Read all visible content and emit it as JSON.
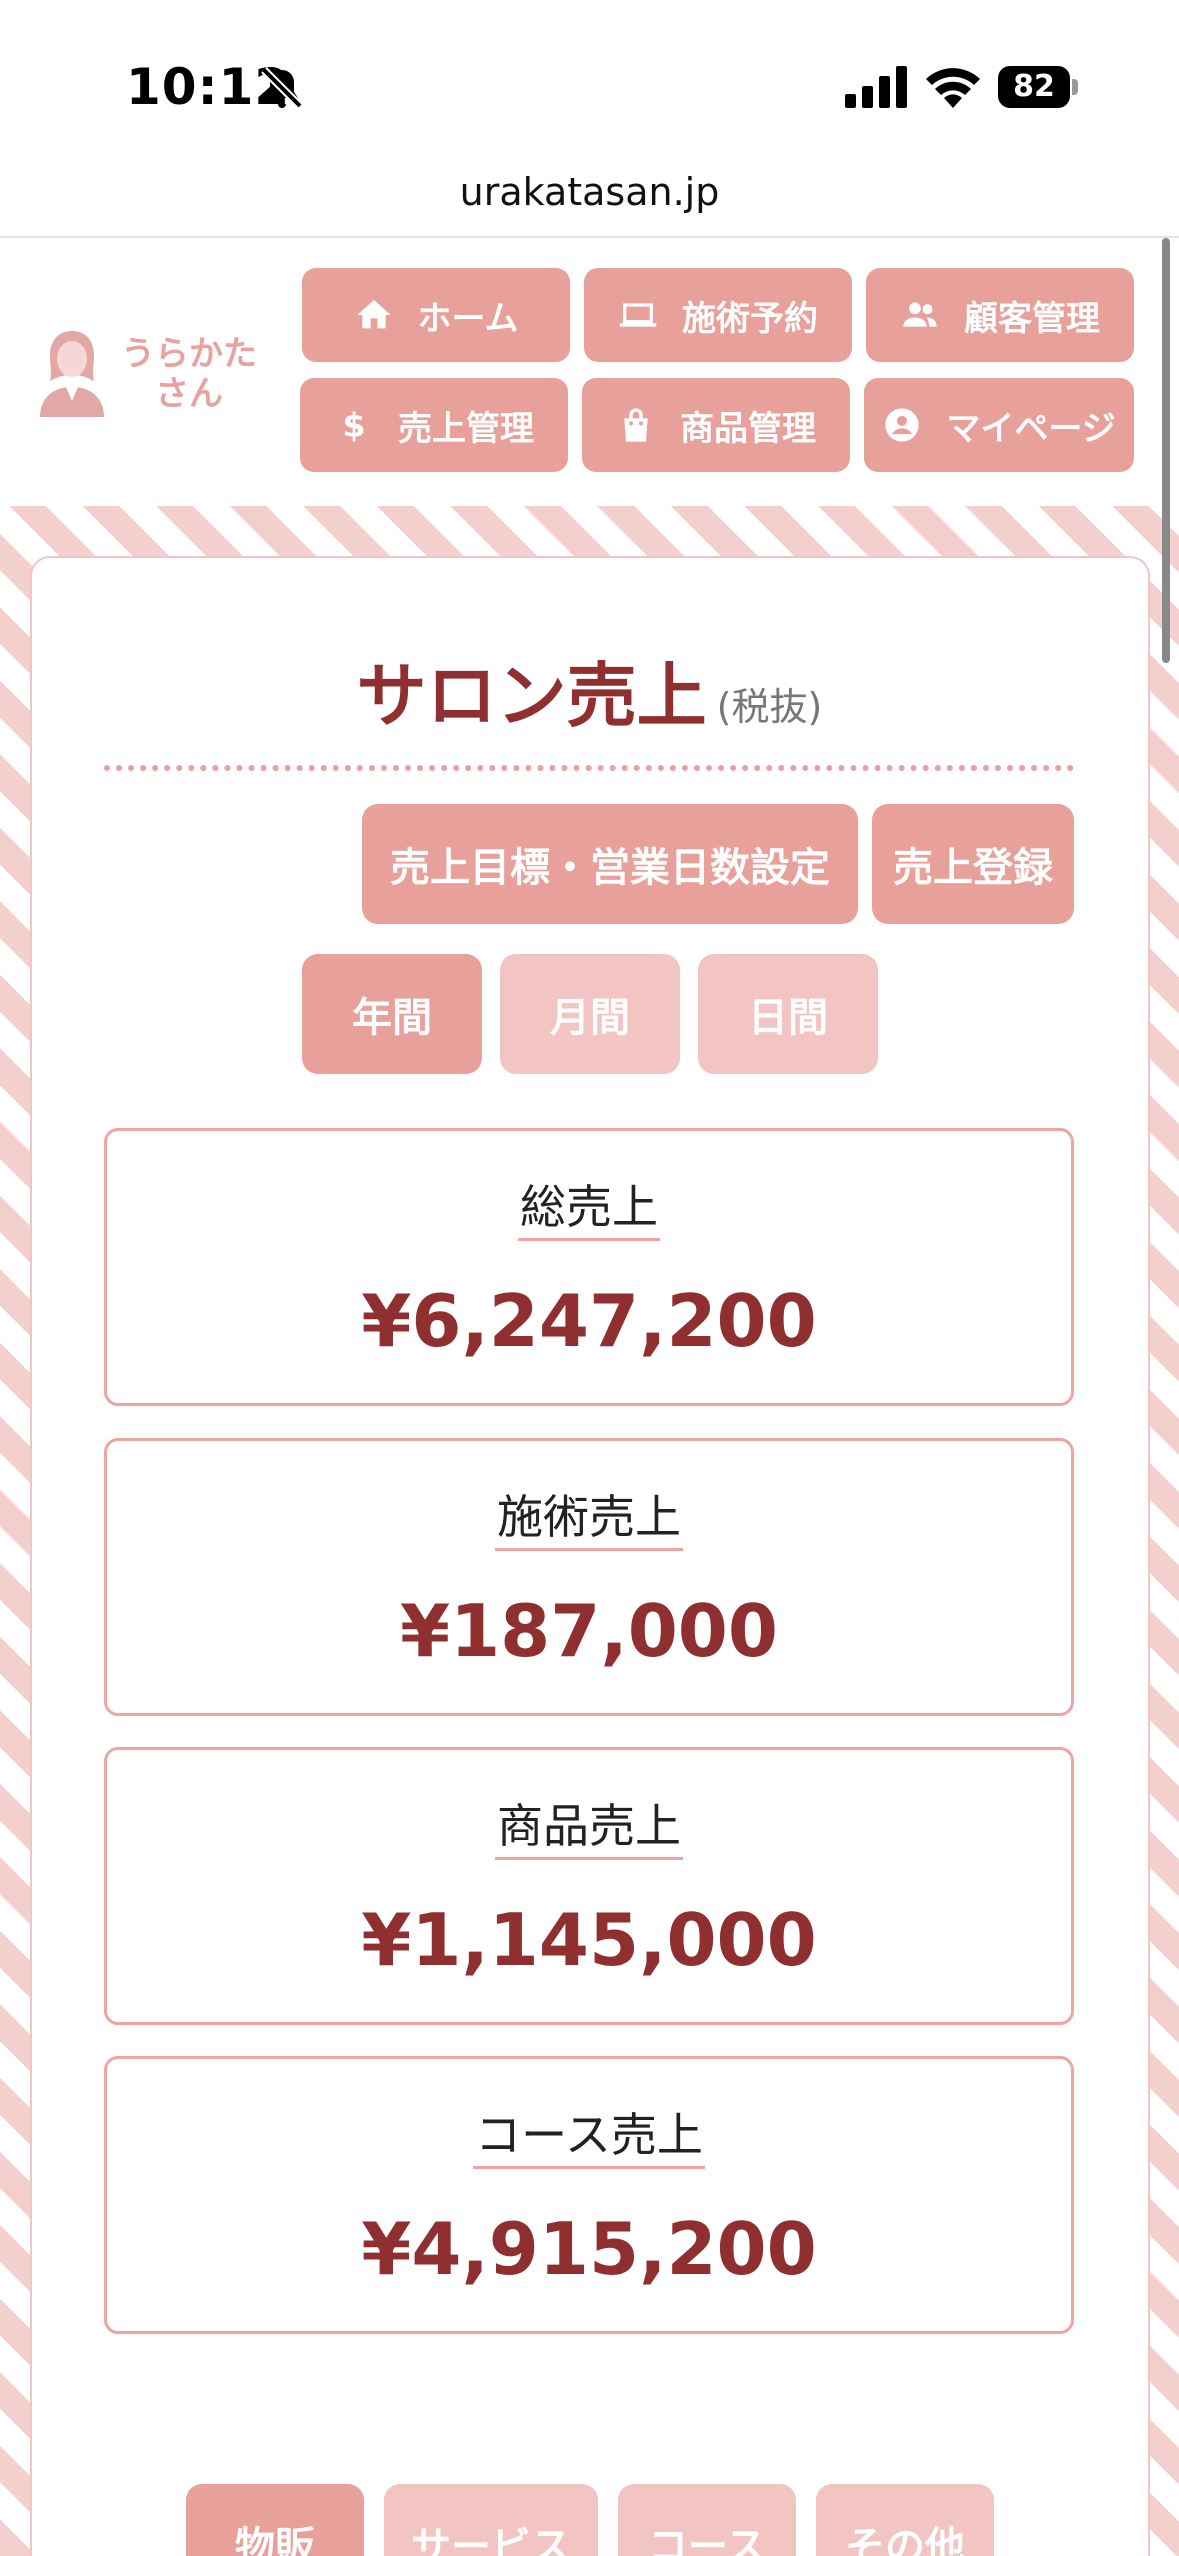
{
  "status_bar": {
    "time": "10:12",
    "battery": "82"
  },
  "browser": {
    "url": "urakatasan.jp"
  },
  "logo": {
    "line1": "うらかた",
    "line2": "さん"
  },
  "nav": [
    {
      "label": "ホーム",
      "icon": "home-icon"
    },
    {
      "label": "施術予約",
      "icon": "laptop-icon"
    },
    {
      "label": "顧客管理",
      "icon": "people-icon"
    },
    {
      "label": "売上管理",
      "icon": "dollar-icon"
    },
    {
      "label": "商品管理",
      "icon": "shopping-bag-icon"
    },
    {
      "label": "マイページ",
      "icon": "account-circle-icon"
    }
  ],
  "page": {
    "title": "サロン売上",
    "subtitle": "(税抜)"
  },
  "actions": {
    "goal_settings": "売上目標・営業日数設定",
    "register_sales": "売上登録"
  },
  "periods": [
    {
      "label": "年間",
      "active": true
    },
    {
      "label": "月間",
      "active": false
    },
    {
      "label": "日間",
      "active": false
    }
  ],
  "summary": [
    {
      "label": "総売上",
      "value": "¥6,247,200"
    },
    {
      "label": "施術売上",
      "value": "¥187,000"
    },
    {
      "label": "商品売上",
      "value": "¥1,145,000"
    },
    {
      "label": "コース売上",
      "value": "¥4,915,200"
    }
  ],
  "category_tabs": [
    {
      "label": "物販",
      "active": true
    },
    {
      "label": "サービス",
      "active": false
    },
    {
      "label": "コース",
      "active": false
    },
    {
      "label": "その他",
      "active": false
    }
  ],
  "colors": {
    "accent": "#e8a09b",
    "accent_light": "#f2c5c3",
    "value_text": "#8f2f2f"
  }
}
